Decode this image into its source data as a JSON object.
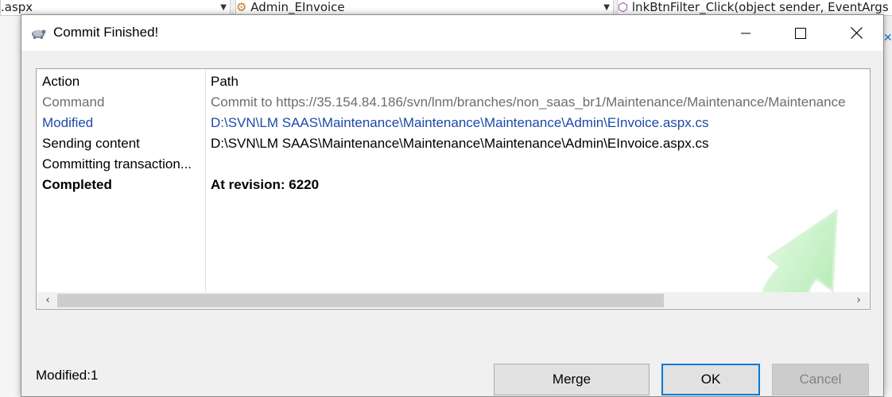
{
  "ide": {
    "file_combo": ".aspx",
    "class_combo": "Admin_EInvoice",
    "member_combo": "lnkBtnFilter_Click(object sender, EventArgs e)"
  },
  "dialog": {
    "title": "Commit Finished!",
    "controls": {
      "minimize": "minimize",
      "maximize": "maximize",
      "close": "close"
    }
  },
  "log": {
    "columns": {
      "action": "Action",
      "path": "Path"
    },
    "rows": [
      {
        "action": "Command",
        "path": "Commit to https://35.154.84.186/svn/lnm/branches/non_saas_br1/Maintenance/Maintenance/Maintenance",
        "style": "gray"
      },
      {
        "action": "Modified",
        "path": "D:\\SVN\\LM SAAS\\Maintenance\\Maintenance\\Maintenance\\Admin\\EInvoice.aspx.cs",
        "style": "blue"
      },
      {
        "action": "Sending content",
        "path": "D:\\SVN\\LM SAAS\\Maintenance\\Maintenance\\Maintenance\\Admin\\EInvoice.aspx.cs",
        "style": "black"
      },
      {
        "action": "Committing transaction...",
        "path": "",
        "style": "black"
      },
      {
        "action": "Completed",
        "path": "At revision: 6220",
        "style": "bold"
      }
    ]
  },
  "status": {
    "modified": "Modified:1"
  },
  "buttons": {
    "merge": "Merge",
    "ok": "OK",
    "cancel": "Cancel"
  },
  "colors": {
    "accent": "#0078d7",
    "modified_blue": "#1b4aa8",
    "command_gray": "#6d6d6d",
    "arrow_green": "#a8e8a8"
  }
}
